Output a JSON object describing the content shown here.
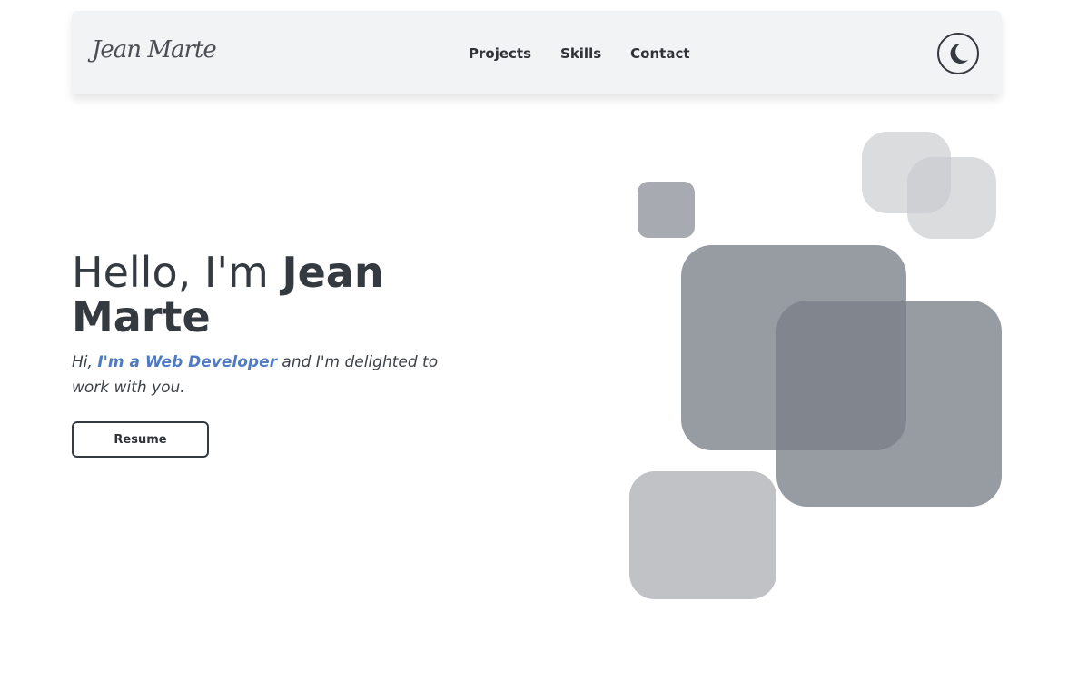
{
  "navbar": {
    "brand": "Jean Marte",
    "links": [
      "Projects",
      "Skills",
      "Contact"
    ],
    "theme_toggle_icon": "moon-icon"
  },
  "hero": {
    "title_prefix": "Hello, I'm ",
    "title_name": "Jean Marte",
    "subtitle_intro": "Hi, ",
    "subtitle_accent": "I'm a Web Developer",
    "subtitle_rest": " and I'm delighted to work with you.",
    "resume_label": "Resume"
  },
  "colors": {
    "navbar_bg": "#f2f3f5",
    "text": "#343a40",
    "accent": "#4f7bc4",
    "shape_dark": "#6b7078",
    "shape_light": "#c0c2c6"
  }
}
